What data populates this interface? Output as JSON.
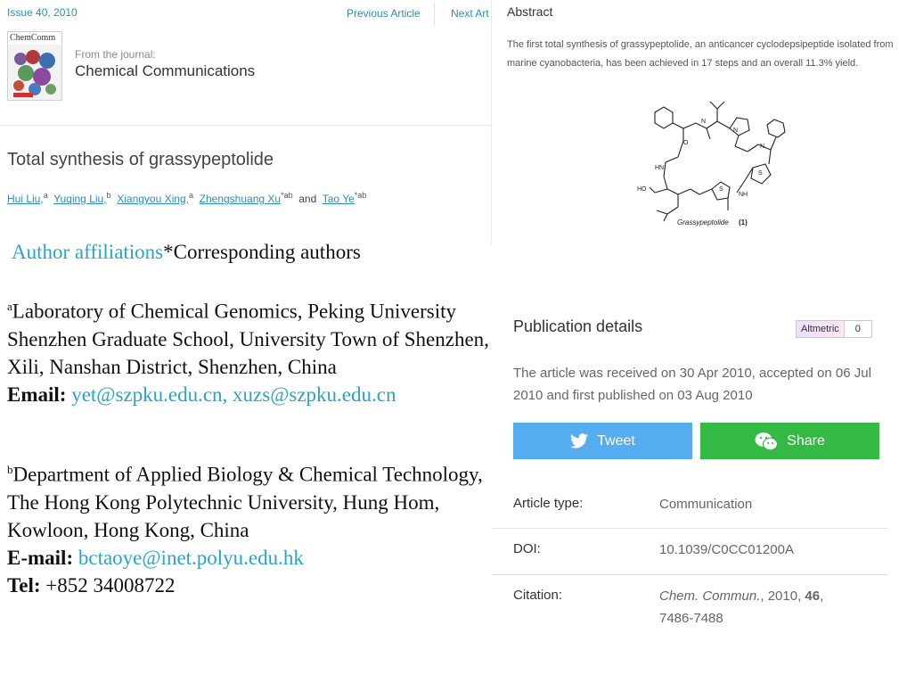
{
  "nav": {
    "issue": "Issue 40, 2010",
    "previous": "Previous Article",
    "next": "Next Art"
  },
  "journal": {
    "cover_title": "ChemComm",
    "from_label": "From the journal:",
    "name": "Chemical Communications"
  },
  "article": {
    "title": "Total synthesis of grassypeptolide",
    "authors": [
      {
        "name": "Hui Liu,",
        "sup": "a"
      },
      {
        "name": "Yuqing Liu,",
        "sup": "b"
      },
      {
        "name": "Xiangyou Xing,",
        "sup": "a"
      },
      {
        "name": "Zhengshuang Xu",
        "sup": "*ab"
      },
      {
        "and": "and"
      },
      {
        "name": "Tao Ye",
        "sup": "*ab"
      }
    ]
  },
  "affiliations": {
    "header_link": "Author affiliations",
    "header_rest": "*Corresponding authors",
    "a_sup": "a",
    "a_text": "Laboratory of Chemical Genomics, Peking University Shenzhen Graduate School, University Town of Shenzhen, Xili, Nanshan District, Shenzhen, China",
    "a_email_label": "Email:",
    "a_email": "yet@szpku.edu.cn, xuzs@szpku.edu.cn",
    "b_sup": "b",
    "b_text": "Department of Applied Biology & Chemical Technology, The Hong Kong Polytechnic University, Hung Hom, Kowloon, Hong Kong, China",
    "b_email_label": "E-mail:",
    "b_email": "bctaoye@inet.polyu.edu.hk",
    "b_tel_label": "Tel:",
    "b_tel": "+852 34008722"
  },
  "abstract": {
    "label": "Abstract",
    "text": "The first total synthesis of grassypeptolide, an anticancer cyclodepsipeptide isolated from marine cyanobacteria, has been achieved in 17 steps and an overall 11.3% yield.",
    "figure_caption": "Grassypeptolide",
    "figure_number": "(1)"
  },
  "publication": {
    "title": "Publication details",
    "altmetric_label": "Altmetric",
    "altmetric_count": "0",
    "received_text": "The article was received on 30 Apr 2010, accepted on 06 Jul 2010 and first published on 03 Aug 2010",
    "tweet_label": "Tweet",
    "share_label": "Share",
    "article_type_label": "Article type:",
    "article_type": "Communication",
    "doi_label": "DOI:",
    "doi": "10.1039/C0CC01200A",
    "citation_label": "Citation:",
    "citation_journal": "Chem. Commun.",
    "citation_year": ", 2010, ",
    "citation_volume": "46",
    "citation_tail": ",",
    "citation_pages": "7486-7488"
  },
  "colors": {
    "link": "#2aa3c8",
    "tweet": "#55acee",
    "share": "#33b944"
  },
  "icons": [
    "twitter-icon",
    "wechat-icon"
  ]
}
